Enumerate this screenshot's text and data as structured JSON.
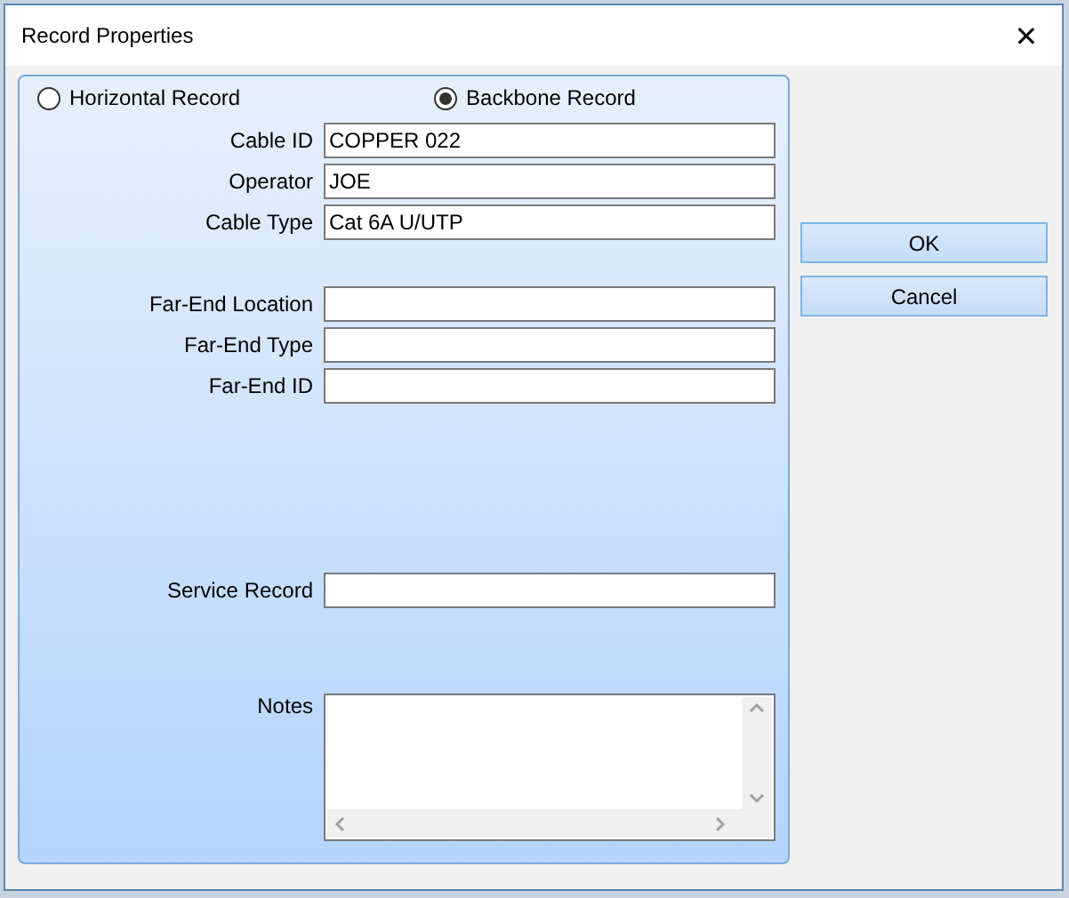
{
  "window": {
    "title": "Record Properties",
    "close": "✕"
  },
  "record_type": [
    {
      "label": "Horizontal Record",
      "selected": false
    },
    {
      "label": "Backbone Record",
      "selected": true
    }
  ],
  "field_groups": [
    [
      {
        "label": "Cable ID",
        "value": "COPPER 022"
      },
      {
        "label": "Operator",
        "value": "JOE"
      },
      {
        "label": "Cable Type",
        "value": "Cat 6A U/UTP"
      }
    ],
    [
      {
        "label": "Far-End Location"
      },
      {
        "label": "Far-End Type"
      },
      {
        "label": "Far-End ID"
      }
    ],
    [
      {
        "label": "Service Record"
      }
    ]
  ],
  "notes": {
    "label": "Notes"
  },
  "buttons": [
    {
      "label": "OK"
    },
    {
      "label": "Cancel"
    }
  ]
}
